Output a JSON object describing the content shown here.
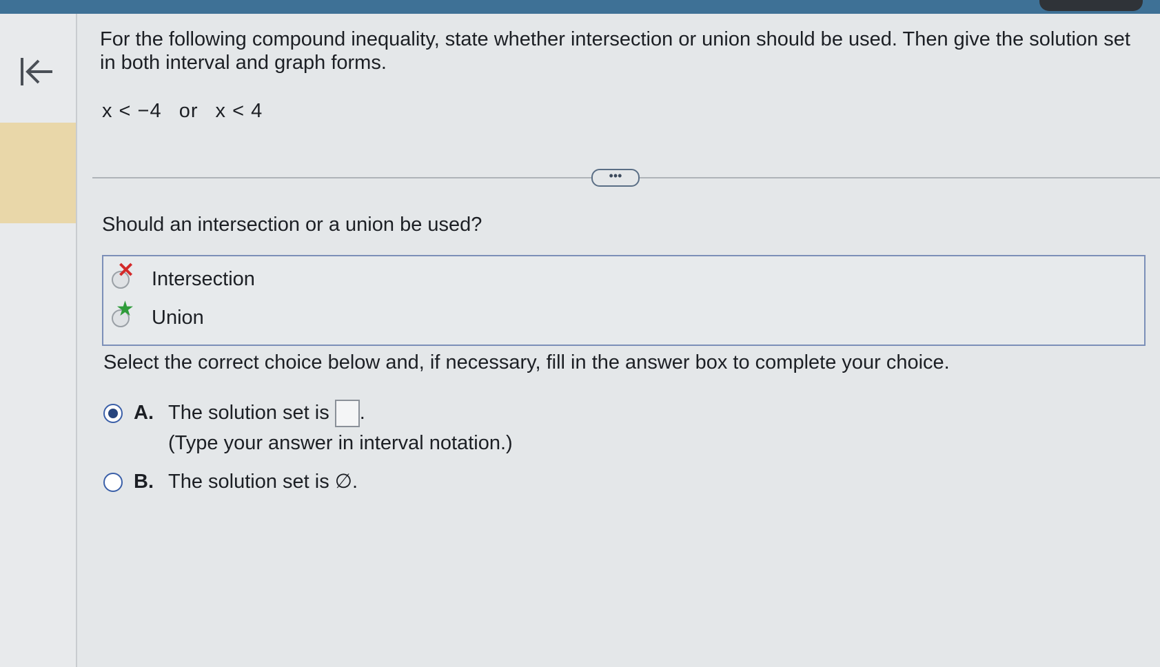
{
  "nav": {
    "back_icon": "arrow-left-to-bar-icon"
  },
  "question": {
    "prompt": "For the following compound inequality, state whether intersection or union should be used. Then give the solution set in both interval and graph forms.",
    "inequality": {
      "left": "x < −4",
      "connector": "or",
      "right": "x < 4"
    }
  },
  "more_button": "•••",
  "part1": {
    "question": "Should an intersection or a union be used?",
    "options": [
      {
        "label": "Intersection",
        "mark": "incorrect-x-icon"
      },
      {
        "label": "Union",
        "mark": "correct-star-icon"
      }
    ]
  },
  "part2": {
    "instruction": "Select the correct choice below and, if necessary, fill in the answer box to complete your choice.",
    "options": [
      {
        "letter": "A.",
        "text": "The solution set is",
        "suffix": ".",
        "hint": "(Type your answer in interval notation.)",
        "selected": true
      },
      {
        "letter": "B.",
        "text": "The solution set is ∅.",
        "selected": false
      }
    ]
  },
  "colors": {
    "accent": "#3e7196",
    "selected_radio": "#27457e",
    "correct": "#2f9c3a",
    "incorrect": "#d32a2a"
  }
}
